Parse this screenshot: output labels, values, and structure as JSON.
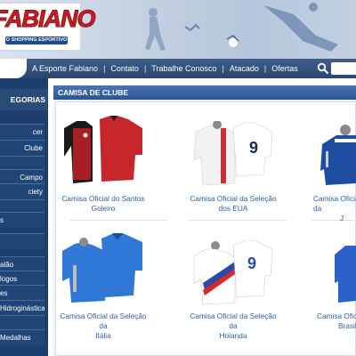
{
  "brand": {
    "logo_text": "FABIANO",
    "tagline": "O SHOPPING ESPORTIVO"
  },
  "nav": {
    "links": [
      "A Esporte Fabiano",
      "Contato",
      "Trabalhe Conosco",
      "Atacado",
      "Ofertas"
    ],
    "separator": "|",
    "search_icon": "search-icon"
  },
  "sidebar": {
    "header": "EGORIAS",
    "items": [
      {
        "label": "cer"
      },
      {
        "label": "Clube"
      },
      {
        "label": ""
      },
      {
        "label": "Campo"
      },
      {
        "label": "ciety"
      },
      {
        "label": ""
      },
      {
        "label": "s"
      },
      {
        "label": ""
      },
      {
        "label": "alão"
      },
      {
        "label": "logos"
      },
      {
        "label": "es"
      },
      {
        "label": "Hidroginástica"
      },
      {
        "label": ""
      },
      {
        "label": "Medalhas"
      }
    ]
  },
  "section": {
    "title": "CAMISA DE CLUBE"
  },
  "products": [
    {
      "line1": "Camisa Oficial do Santos",
      "line2": "Goleiro",
      "colors": [
        "#c7262b",
        "#1b1b1b"
      ]
    },
    {
      "line1": "Camisa Oficial da Seleção",
      "line2": "dos EUA",
      "colors": [
        "#f2f2f2",
        "#ffffff"
      ]
    },
    {
      "line1": "Camisa Oficial da",
      "line2": "J",
      "colors": [
        "#1e4ea0",
        "#ffffff"
      ]
    },
    {
      "line1": "Camisa Oficial da Seleção da",
      "line2": "Itália",
      "colors": [
        "#2f78d6",
        "#2f78d6"
      ]
    },
    {
      "line1": "Camisa Oficial da Seleção da",
      "line2": "Holanda",
      "colors": [
        "#ffffff",
        "#ffffff"
      ]
    },
    {
      "line1": "Camisa Oficial",
      "line2": "Brasil",
      "colors": [
        "#2a62c9",
        "#2a62c9"
      ]
    }
  ],
  "shirt_numbers": [
    "9",
    "9"
  ],
  "colors": {
    "nav_bar": "#2a4670",
    "sidebar": "#1c3e6d",
    "section_bar": "#2c558f",
    "product_text": "#2d5fa0",
    "logo_red": "#cc1f25"
  }
}
